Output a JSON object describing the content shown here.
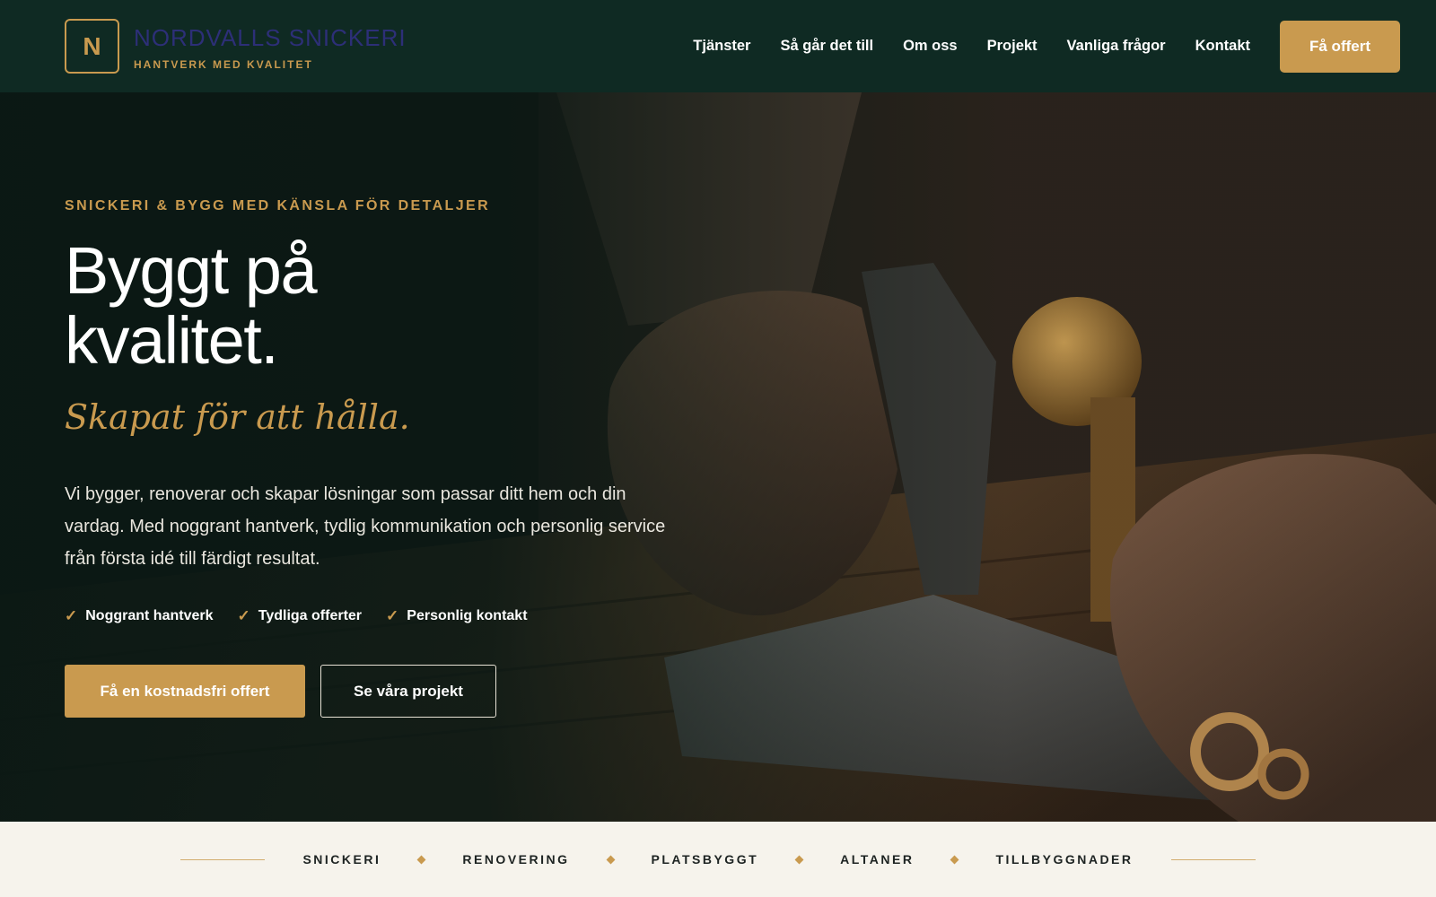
{
  "header": {
    "logo_letter": "N",
    "brand_name": "NORDVALLS SNICKERI",
    "brand_tagline": "HANTVERK MED KVALITET",
    "nav": [
      "Tjänster",
      "Så går det till",
      "Om oss",
      "Projekt",
      "Vanliga frågor",
      "Kontakt"
    ],
    "cta_label": "Få offert"
  },
  "hero": {
    "eyebrow": "SNICKERI & BYGG MED KÄNSLA FÖR DETALJER",
    "headline_line1": "Byggt på",
    "headline_line2": "kvalitet.",
    "subheadline": "Skapat för att hålla.",
    "lead": "Vi bygger, renoverar och skapar lösningar som passar ditt hem och din vardag. Med noggrant hantverk, tydlig kommunikation och personlig service från första idé till färdigt resultat.",
    "checkmark_glyph": "✓",
    "checks": [
      "Noggrant hantverk",
      "Tydliga offerter",
      "Personlig kontakt"
    ],
    "primary_button": "Få en kostnadsfri offert",
    "secondary_button": "Se våra projekt"
  },
  "services_strip": [
    "SNICKERI",
    "RENOVERING",
    "PLATSBYGGT",
    "ALTANER",
    "TILLBYGGNADER"
  ],
  "colors": {
    "header_bg": "#0f2a23",
    "accent_gold": "#c99a4f",
    "brand_name": "#2d2f78",
    "strip_bg": "#f6f3ec"
  }
}
